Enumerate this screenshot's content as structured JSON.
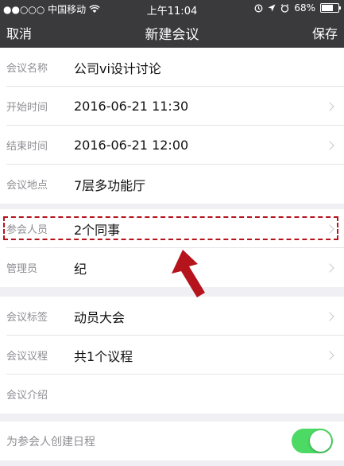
{
  "status_bar": {
    "carrier": "●●○○○ 中国移动",
    "time": "上午11:04",
    "battery": "68%",
    "battery_level": 0.68
  },
  "nav": {
    "cancel": "取消",
    "title": "新建会议",
    "save": "保存"
  },
  "fields": {
    "name": {
      "label": "会议名称",
      "value": "公司vi设计讨论"
    },
    "start": {
      "label": "开始时间",
      "value": "2016-06-21 11:30"
    },
    "end": {
      "label": "结束时间",
      "value": "2016-06-21 12:00"
    },
    "location": {
      "label": "会议地点",
      "value": "7层多功能厅"
    },
    "attendees": {
      "label": "参会人员",
      "value": "2个同事"
    },
    "admin": {
      "label": "管理员",
      "value": "纪"
    },
    "tag": {
      "label": "会议标签",
      "value": "动员大会"
    },
    "agenda": {
      "label": "会议议程",
      "value": "共1个议程"
    },
    "intro": {
      "label": "会议介绍",
      "value": ""
    },
    "calendar": {
      "label": "为参会人创建日程",
      "enabled": true
    }
  },
  "colors": {
    "nav_bg": "#3a3a3d",
    "toggle_on": "#4cd964",
    "highlight": "#b5141d"
  },
  "icons": [
    "wifi-icon",
    "chevron-right-icon",
    "arrow-up-icon",
    "location-icon",
    "alarm-icon"
  ]
}
